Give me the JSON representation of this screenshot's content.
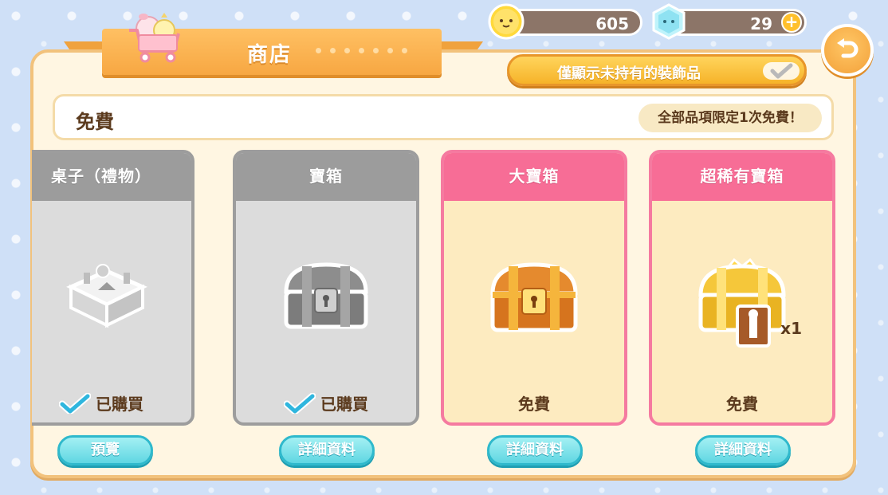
{
  "header": {
    "title": "商店",
    "coins": "605",
    "gems": "29",
    "filter_label": "僅顯示未持有的裝飾品"
  },
  "category": {
    "title": "免費",
    "note": "全部品項限定1次免費！"
  },
  "cards": [
    {
      "title": "桌子（禮物）",
      "status": "已購買",
      "state": "purchased",
      "button": "預覽",
      "icon": "gift-table-icon"
    },
    {
      "title": "寶箱",
      "status": "已購買",
      "state": "purchased",
      "button": "詳細資料",
      "icon": "silver-chest-icon"
    },
    {
      "title": "大寶箱",
      "status": "免費",
      "state": "available",
      "button": "詳細資料",
      "icon": "big-chest-icon"
    },
    {
      "title": "超稀有寶箱",
      "status": "免費",
      "state": "available",
      "button": "詳細資料",
      "icon": "rare-chest-icon",
      "quantity": "x1"
    }
  ],
  "colors": {
    "accent_orange": "#f7a742",
    "card_pink": "#f76d96",
    "card_gray": "#9c9c9c",
    "button_cyan": "#5fd6e2"
  }
}
